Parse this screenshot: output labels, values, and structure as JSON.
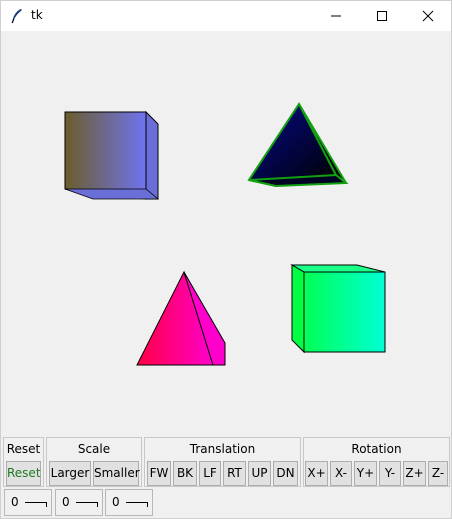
{
  "window": {
    "title": "tk",
    "icons": [
      "feather-icon",
      "minimize-icon",
      "maximize-icon",
      "close-icon"
    ]
  },
  "controls": {
    "reset": {
      "title": "Reset",
      "button": "Reset",
      "button_color": "#1e7a1e"
    },
    "scale": {
      "title": "Scale",
      "buttons": [
        "Larger",
        "Smaller"
      ]
    },
    "translation": {
      "title": "Translation",
      "buttons": [
        "FW",
        "BK",
        "LF",
        "RT",
        "UP",
        "DN"
      ]
    },
    "rotation": {
      "title": "Rotation",
      "buttons": [
        "X+",
        "X-",
        "Y+",
        "Y-",
        "Z+",
        "Z-"
      ]
    }
  },
  "spinners": [
    {
      "value": "0"
    },
    {
      "value": "0"
    },
    {
      "value": "0"
    }
  ],
  "scene": {
    "objects": [
      {
        "name": "cube",
        "gradient": [
          "#6b5d2a",
          "#6f74f0"
        ],
        "outline": "#000000"
      },
      {
        "name": "pyramid",
        "gradient": [
          "#050a8c",
          "#000000"
        ],
        "outline": "#10a010"
      },
      {
        "name": "pyramid",
        "gradient": [
          "#ff0044",
          "#ff00cc"
        ],
        "outline": "#000000"
      },
      {
        "name": "cube",
        "gradient": [
          "#00ff55",
          "#00ffd4"
        ],
        "outline": "#000000"
      }
    ]
  }
}
